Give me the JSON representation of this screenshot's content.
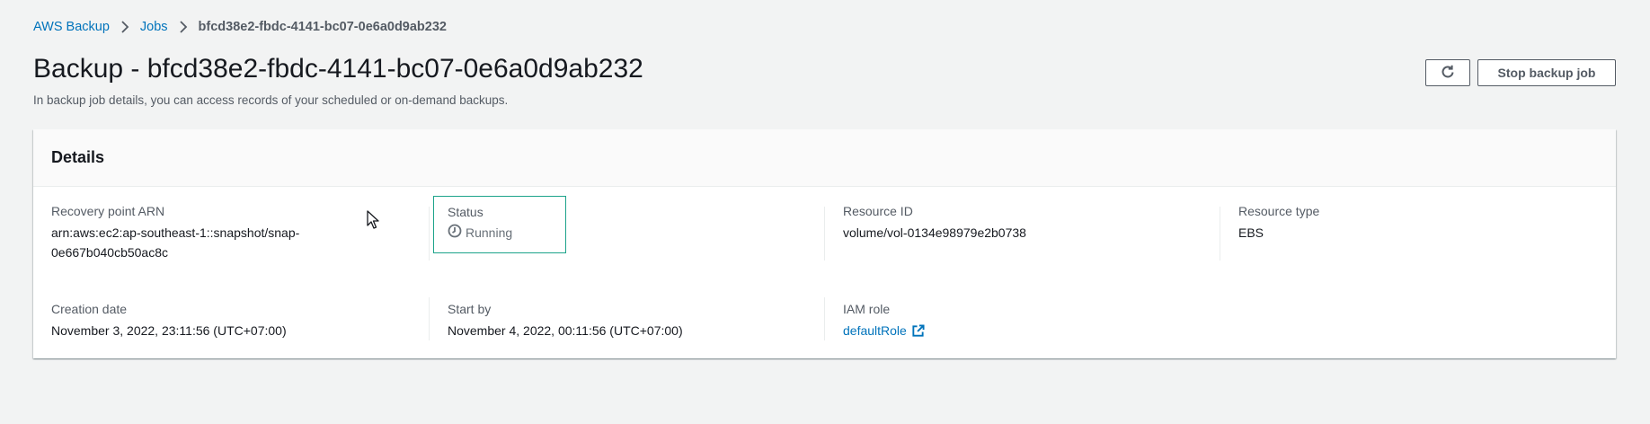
{
  "breadcrumb": {
    "items": [
      {
        "label": "AWS Backup"
      },
      {
        "label": "Jobs"
      }
    ],
    "current": "bfcd38e2-fbdc-4141-bc07-0e6a0d9ab232"
  },
  "header": {
    "title": "Backup - bfcd38e2-fbdc-4141-bc07-0e6a0d9ab232",
    "description": "In backup job details, you can access records of your scheduled or on-demand backups.",
    "refresh_icon": "refresh-icon",
    "stop_label": "Stop backup job"
  },
  "details": {
    "title": "Details",
    "recovery_point_arn": {
      "label": "Recovery point ARN",
      "value_line1": "arn:aws:ec2:ap-southeast-1::snapshot/snap-",
      "value_line2": "0e667b040cb50ac8c"
    },
    "status": {
      "label": "Status",
      "value": "Running",
      "icon": "clock-icon",
      "highlight_color": "#1ca38a"
    },
    "resource_id": {
      "label": "Resource ID",
      "value": "volume/vol-0134e98979e2b0738"
    },
    "resource_type": {
      "label": "Resource type",
      "value": "EBS"
    },
    "creation_date": {
      "label": "Creation date",
      "value": "November 3, 2022, 23:11:56 (UTC+07:00)"
    },
    "start_by": {
      "label": "Start by",
      "value": "November 4, 2022, 00:11:56 (UTC+07:00)"
    },
    "iam_role": {
      "label": "IAM role",
      "value": "defaultRole",
      "icon": "external-link-icon"
    }
  },
  "colors": {
    "link": "#0073bb",
    "background": "#f2f3f3",
    "status_border": "#1ca38a"
  }
}
